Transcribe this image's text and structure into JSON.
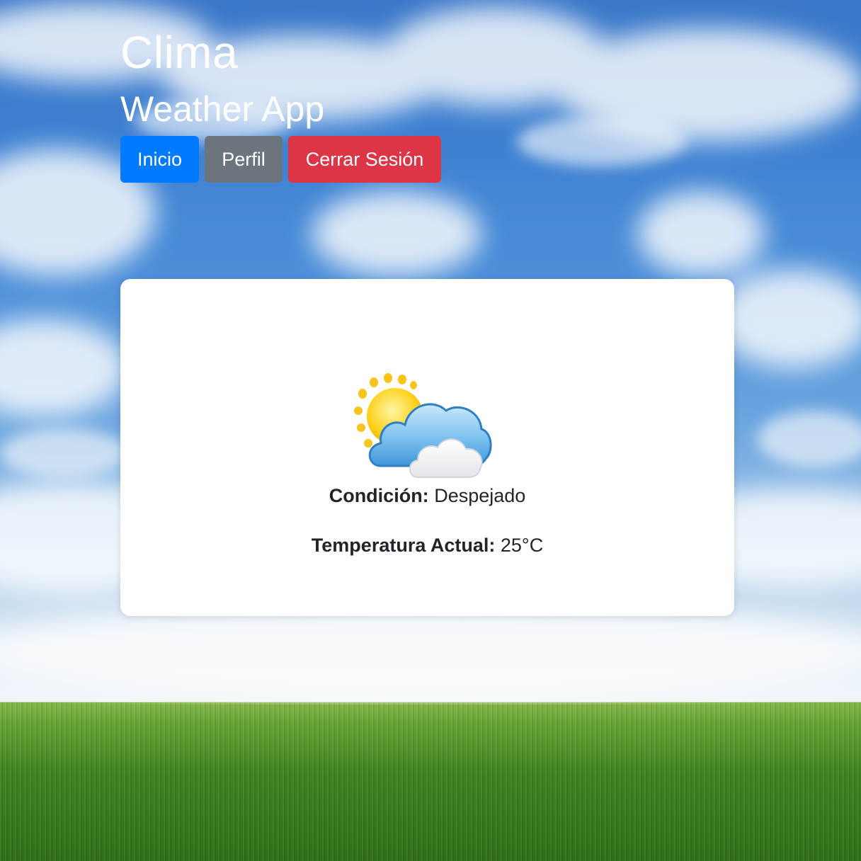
{
  "header": {
    "title": "Clima",
    "subtitle": "Weather App"
  },
  "nav": {
    "home_label": "Inicio",
    "profile_label": "Perfil",
    "logout_label": "Cerrar Sesión"
  },
  "weather": {
    "icon": "partly-cloudy-icon",
    "condition_label": "Condición:",
    "condition_value": "Despejado",
    "temperature_label": "Temperatura Actual:",
    "temperature_value": "25°C"
  },
  "colors": {
    "primary": "#007bff",
    "secondary": "#6c757d",
    "danger": "#dc3545",
    "card_background": "#ffffff",
    "text": "#212529"
  }
}
